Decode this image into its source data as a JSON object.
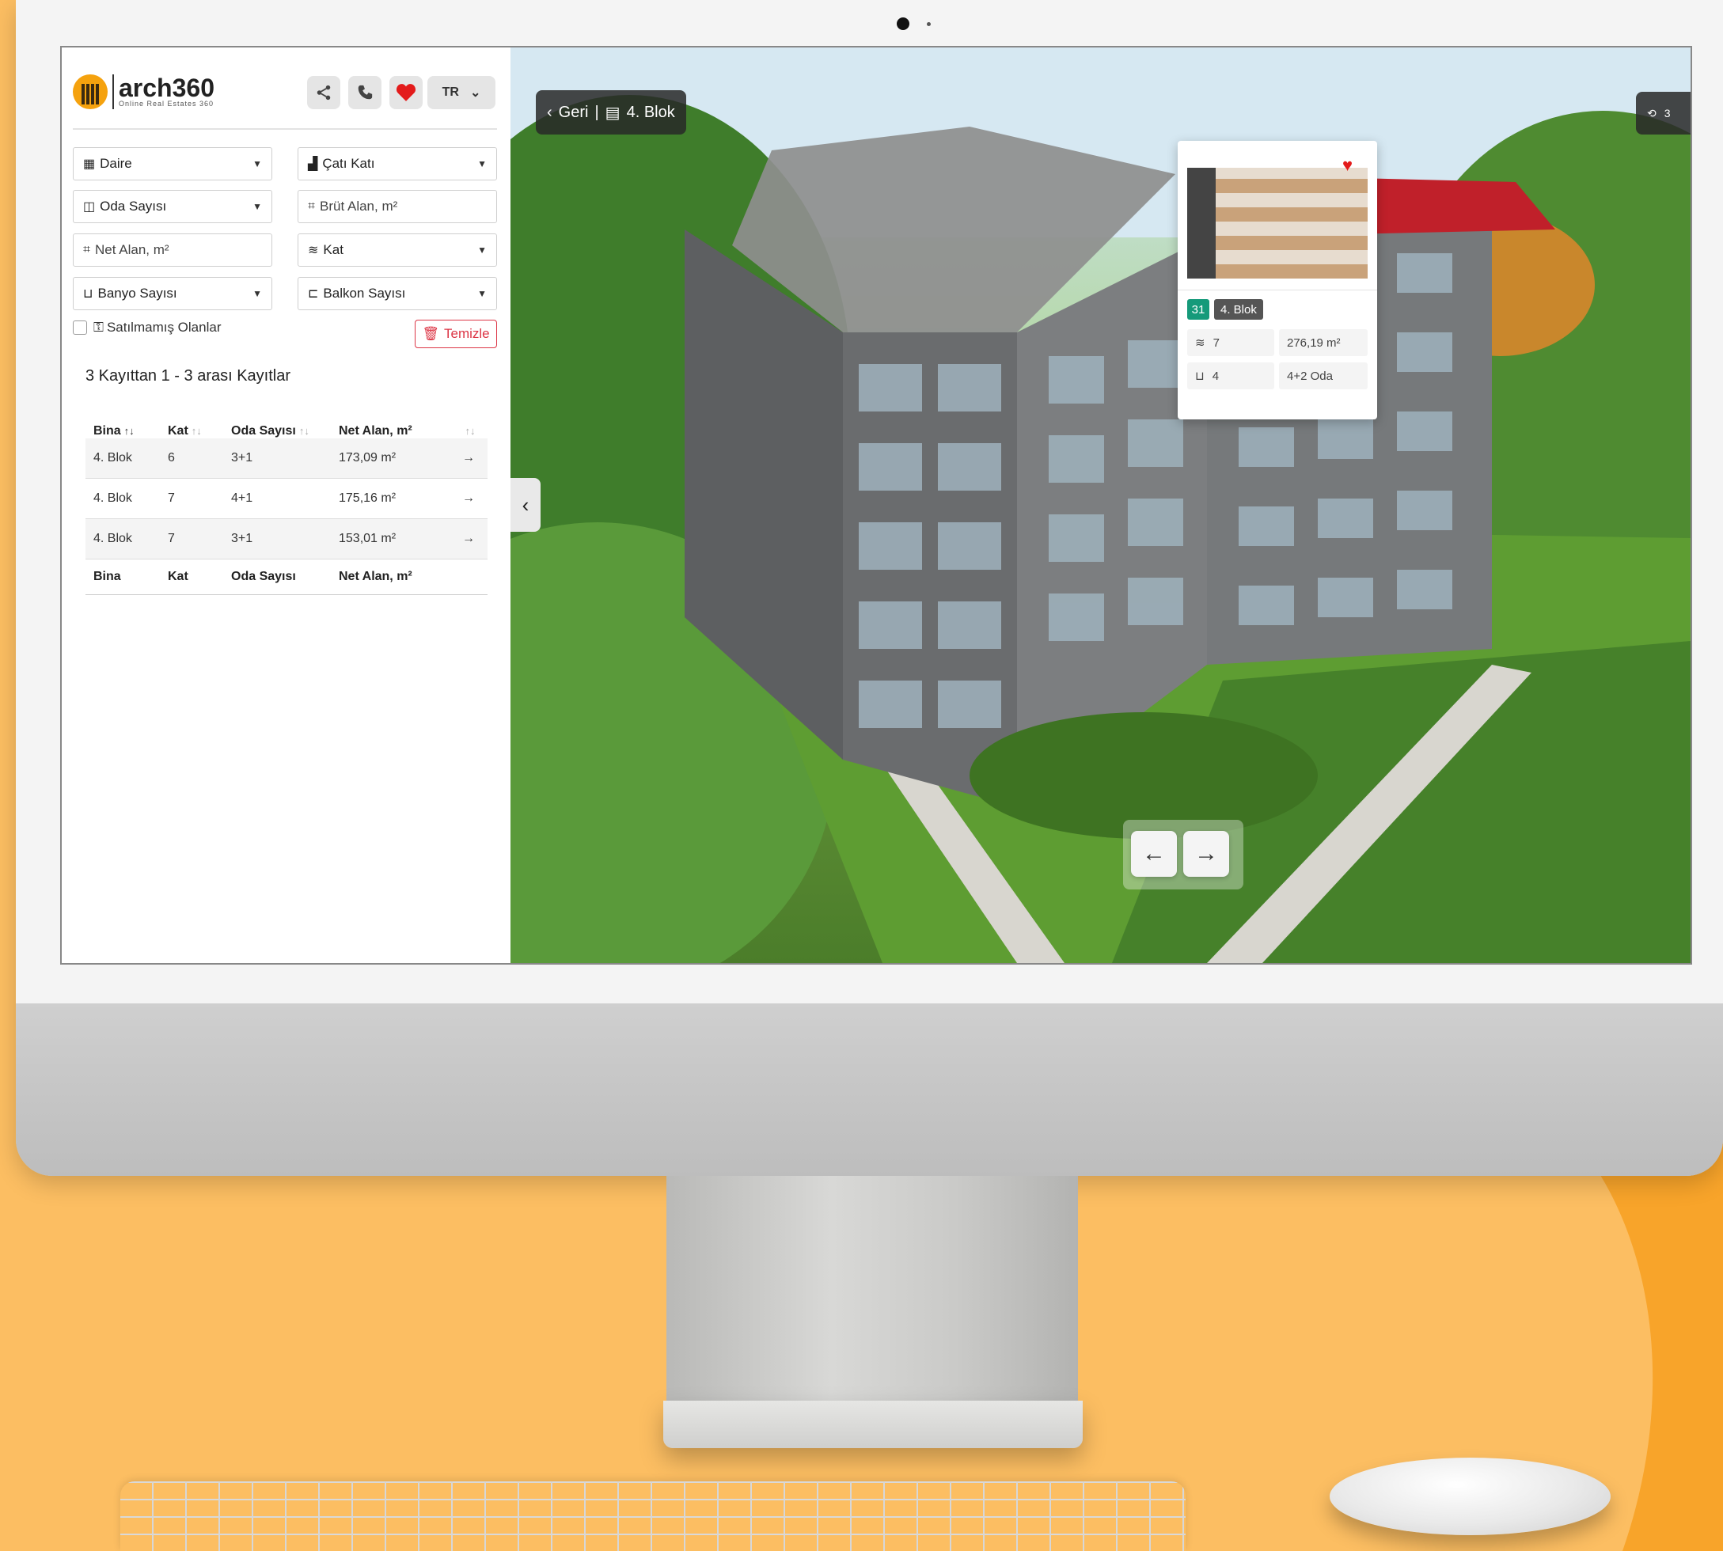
{
  "app": {
    "logo_name": "arch360",
    "logo_tagline": "Online Real Estates 360",
    "lang": "TR"
  },
  "colors": {
    "background": "#fcbe62",
    "accent_red": "#e31b1b",
    "danger": "#dc3545",
    "badge_green": "#159a7a"
  },
  "icons": {
    "share": "share-icon",
    "phone": "phone-icon",
    "favorite": "heart-icon",
    "chevron": "chevron-down-icon"
  },
  "filters": {
    "type": "Daire",
    "floor_type": "Çatı Katı",
    "rooms": "Oda Sayısı",
    "gross_area": "Brüt Alan, m²",
    "net_area": "Net Alan, m²",
    "floor": "Kat",
    "bathrooms": "Banyo Sayısı",
    "balconies": "Balkon Sayısı",
    "unsold": "Satılmamış Olanlar",
    "clear": "Temizle"
  },
  "records_label": "3 Kayıttan 1 - 3 arası Kayıtlar",
  "table": {
    "headers": [
      "Bina",
      "Kat",
      "Oda Sayısı",
      "Net Alan, m²"
    ],
    "rows": [
      {
        "bina": "4. Blok",
        "kat": "6",
        "oda": "3+1",
        "alan": "173,09 m²"
      },
      {
        "bina": "4. Blok",
        "kat": "7",
        "oda": "4+1",
        "alan": "175,16 m²"
      },
      {
        "bina": "4. Blok",
        "kat": "7",
        "oda": "3+1",
        "alan": "153,01 m²"
      }
    ],
    "footer": [
      "Bina",
      "Kat",
      "Oda Sayısı",
      "Net Alan, m²"
    ]
  },
  "viewer": {
    "back_label": "Geri",
    "block_label": "4. Blok",
    "view360_label": "3",
    "card": {
      "number": "31",
      "block": "4. Blok",
      "floor": "7",
      "area": "276,19 m²",
      "bath": "4",
      "rooms": "4+2 Oda"
    }
  }
}
